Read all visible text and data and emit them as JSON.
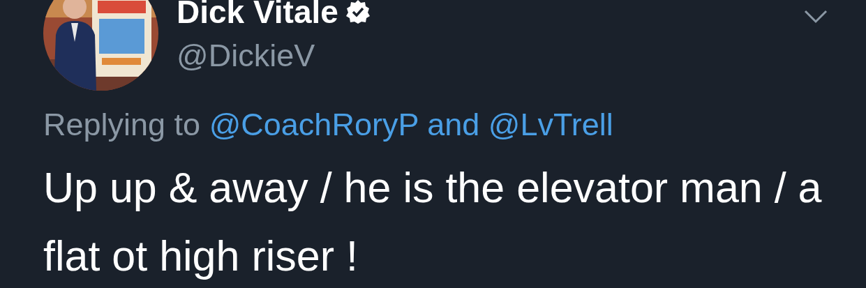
{
  "author": {
    "name": "Dick Vitale",
    "verified": true,
    "handle": "@DickieV"
  },
  "reply_to": {
    "prefix": "Replying to",
    "joiner": "and",
    "mentions": [
      "@CoachRoryP",
      "@LvTrell"
    ]
  },
  "text": "Up up & away / he is the elevator man / a flat ot high riser !"
}
